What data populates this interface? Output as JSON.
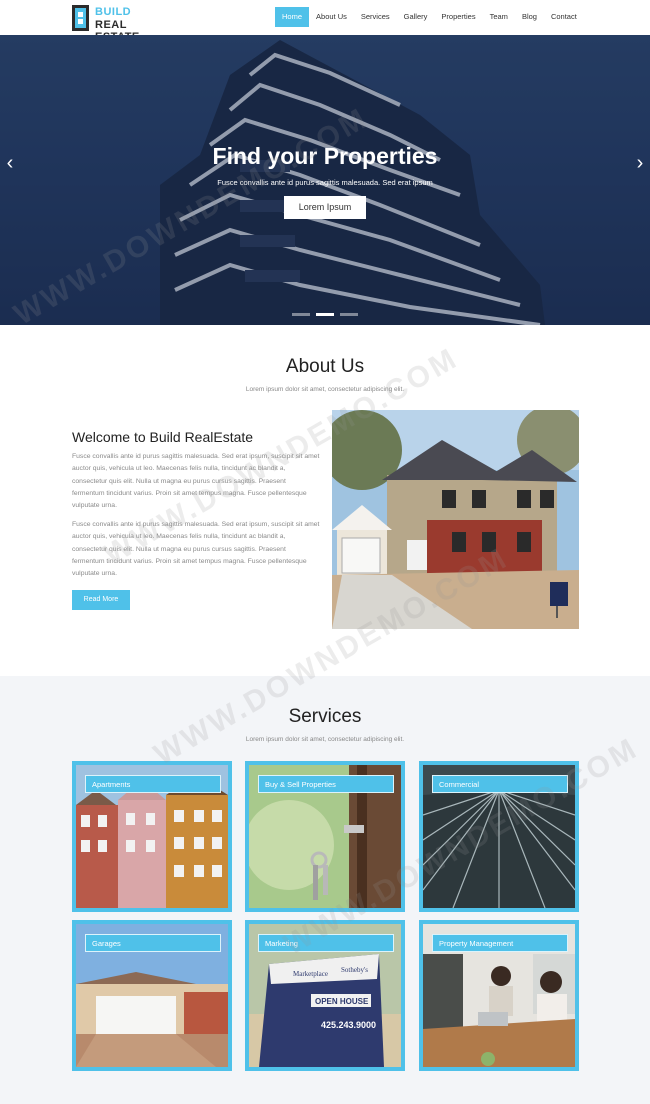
{
  "header": {
    "logo": {
      "line1": "BUILD",
      "line2": "REAL ESTATE"
    },
    "nav": [
      "Home",
      "About Us",
      "Services",
      "Gallery",
      "Properties",
      "Team",
      "Blog",
      "Contact"
    ]
  },
  "hero": {
    "title": "Find your Properties",
    "subtitle": "Fusce convallis ante id purus sagittis malesuada. Sed erat ipsum",
    "button": "Lorem Ipsum",
    "prev_icon": "chevron-left-icon",
    "next_icon": "chevron-right-icon",
    "active_slide": 2,
    "slide_count": 3
  },
  "about": {
    "title": "About Us",
    "subtitle": "Lorem ipsum dolor sit amet, consectetur adipiscing elit.",
    "heading": "Welcome to Build RealEstate",
    "paragraph1": "Fusce convallis ante id purus sagittis malesuada. Sed erat ipsum, suscipit sit amet auctor quis, vehicula ut leo. Maecenas felis nulla, tincidunt ac blandit a, consectetur quis elit. Nulla ut magna eu purus cursus sagittis. Praesent fermentum tincidunt varius. Proin sit amet tempus magna. Fusce pellentesque vulputate urna.",
    "paragraph2": "Fusce convallis ante id purus sagittis malesuada. Sed erat ipsum, suscipit sit amet auctor quis, vehicula ut leo. Maecenas felis nulla, tincidunt ac blandit a, consectetur quis elit. Nulla ut magna eu purus cursus sagittis. Praesent fermentum tincidunt varius. Proin sit amet tempus magna. Fusce pellentesque vulputate urna.",
    "button": "Read More"
  },
  "services": {
    "title": "Services",
    "subtitle": "Lorem ipsum dolor sit amet, consectetur adipiscing elit.",
    "items": [
      "Apartments",
      "Buy & Sell Properties",
      "Commercial",
      "Garages",
      "Marketing",
      "Property Management"
    ]
  },
  "marketing_sign": {
    "line1": "Marketplace",
    "line2": "Sotheby's",
    "line3": "OPEN HOUSE",
    "line4": "425.243.9000"
  },
  "watermark": "WWW.DOWNDEMO.COM",
  "colors": {
    "accent": "#4fc1e9",
    "hero_bg": "#27406a",
    "services_bg": "#f3f5f8"
  }
}
